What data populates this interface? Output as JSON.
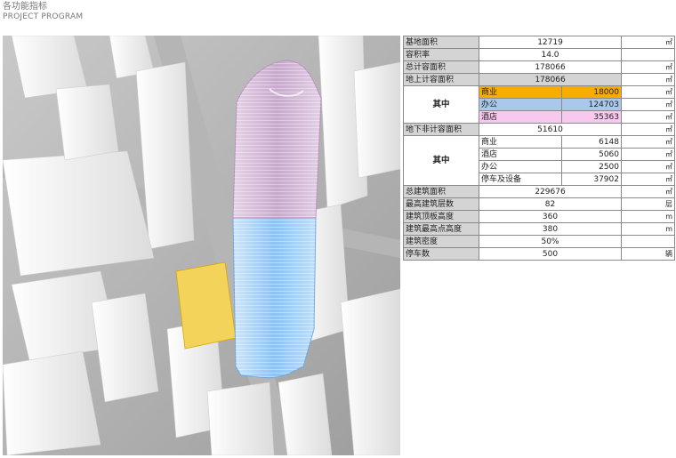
{
  "header": {
    "title_cn": "各功能指标",
    "title_en": "PROJECT PROGRAM"
  },
  "image": {
    "subject-icon": "tower-rendering"
  },
  "table": {
    "site_area": {
      "label": "基地面积",
      "value": "12719",
      "unit": "㎡"
    },
    "far": {
      "label": "容积率",
      "value": "14.0",
      "unit": ""
    },
    "total_far_area": {
      "label": "总计容面积",
      "value": "178066",
      "unit": "㎡"
    },
    "above_far_area": {
      "label": "地上计容面积",
      "value": "178066",
      "unit": "㎡"
    },
    "above_group_label": "其中",
    "above_items": [
      {
        "label": "商业",
        "value": "18000",
        "unit": "㎡"
      },
      {
        "label": "办公",
        "value": "124703",
        "unit": "㎡"
      },
      {
        "label": "酒店",
        "value": "35363",
        "unit": "㎡"
      }
    ],
    "below_nonfar_area": {
      "label": "地下非计容面积",
      "value": "51610",
      "unit": "㎡"
    },
    "below_group_label": "其中",
    "below_items": [
      {
        "label": "商业",
        "value": "6148",
        "unit": "㎡"
      },
      {
        "label": "酒店",
        "value": "5060",
        "unit": "㎡"
      },
      {
        "label": "办公",
        "value": "2500",
        "unit": "㎡"
      },
      {
        "label": "停车及设备",
        "value": "37902",
        "unit": "㎡"
      }
    ],
    "gfa": {
      "label": "总建筑面积",
      "value": "229676",
      "unit": "㎡"
    },
    "floors": {
      "label": "最高建筑层数",
      "value": "82",
      "unit": "层"
    },
    "roof_height": {
      "label": "建筑顶板高度",
      "value": "360",
      "unit": "m"
    },
    "top_height": {
      "label": "建筑最高点高度",
      "value": "380",
      "unit": "m"
    },
    "density": {
      "label": "建筑密度",
      "value": "50%",
      "unit": ""
    },
    "parking": {
      "label": "停车数",
      "value": "500",
      "unit": "辆"
    }
  },
  "colors": {
    "retail": "#f7ac00",
    "office": "#a9c8ea",
    "hotel": "#f7c9ee",
    "header_gray": "#d4d4d4"
  }
}
